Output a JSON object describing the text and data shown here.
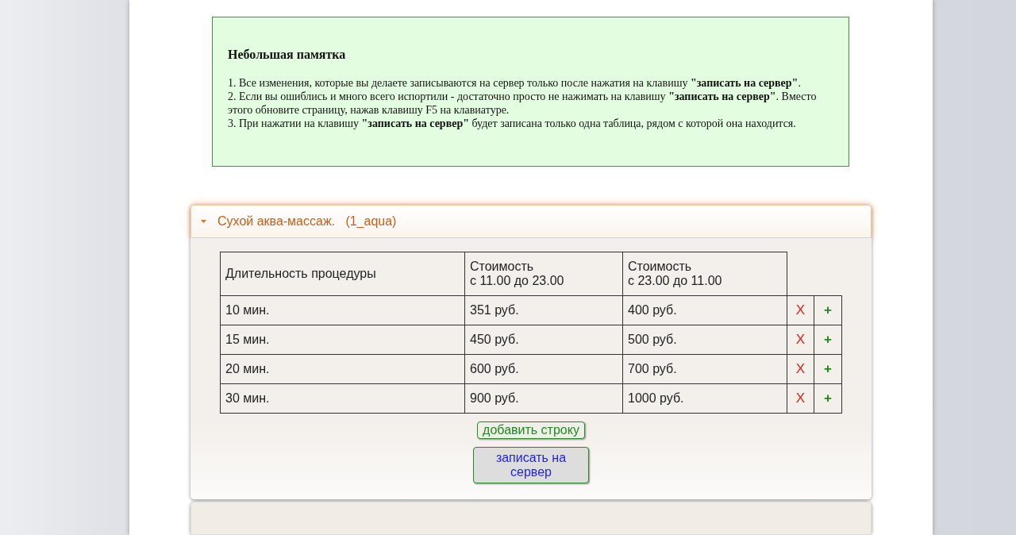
{
  "note": {
    "title": "Небольшая памятка",
    "items": [
      "1. Все изменения, которые вы делаете записываются на сервер только после нажатия на клавишу **\"записать на сервер\"**.",
      "2. Если вы ошиблись и много всего испортили - достаточно просто не нажимать на клавишу **\"записать на сервер\"**. Вместо этого обновите страницу, нажав клавишу F5 на клавиатуре.",
      "3. При нажатии на клавишу **\"записать на сервер\"** будет записана только одна таблица, рядом с которой она находится."
    ]
  },
  "panels": [
    {
      "title": "Сухой аква-массаж.   (1_aqua)",
      "expanded": true,
      "table": {
        "columns": [
          "Длительность процедуры",
          "Стоимость\nс 11.00 до 23.00",
          "Стоимость\n с 23.00 до 11.00"
        ],
        "rows": [
          {
            "cells": [
              "10 мин.",
              "351 руб.",
              "400 руб."
            ],
            "delete": "X",
            "add": "+"
          },
          {
            "cells": [
              "15 мин.",
              "450 руб.",
              "500 руб."
            ],
            "delete": "X",
            "add": "+"
          },
          {
            "cells": [
              "20 мин.",
              "600 руб.",
              "700 руб."
            ],
            "delete": "X",
            "add": "+"
          },
          {
            "cells": [
              "30 мин.",
              "900 руб.",
              "1000 руб."
            ],
            "delete": "X",
            "add": "+"
          }
        ]
      },
      "add_row_button": "добавить строку",
      "save_button": "записать на сервер"
    },
    {
      "expanded": false
    }
  ]
}
